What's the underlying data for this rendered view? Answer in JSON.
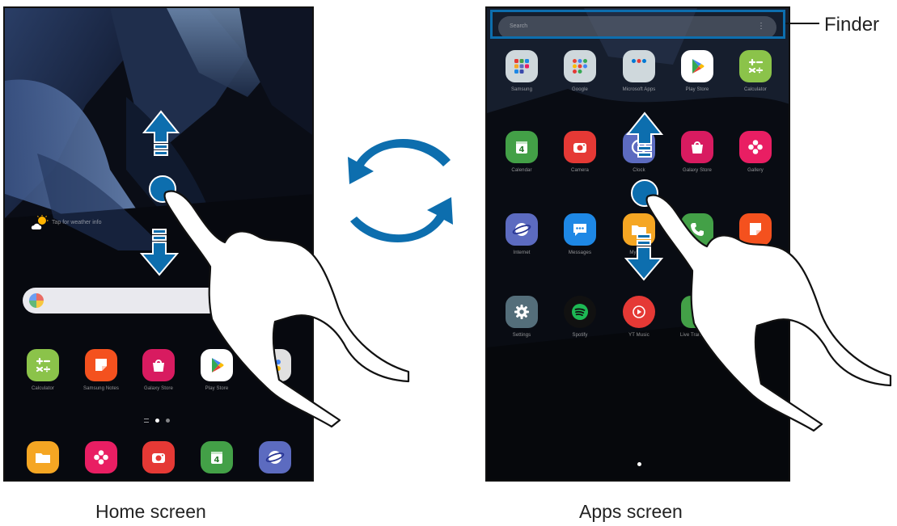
{
  "home_screen": {
    "weather_text": "Tap for weather info",
    "apps_row": [
      {
        "label": "Calculator",
        "icon": "calculator-icon",
        "color": "#8bc34a"
      },
      {
        "label": "Samsung Notes",
        "icon": "samsung-notes-icon",
        "color": "#f4511e"
      },
      {
        "label": "Galaxy Store",
        "icon": "galaxy-store-icon",
        "color": "#d81b60"
      },
      {
        "label": "Play Store",
        "icon": "play-store-icon",
        "color": "#ffffff"
      },
      {
        "label": "Google",
        "icon": "google-folder-icon",
        "color": "#e0e0e0"
      }
    ],
    "dock": [
      {
        "label": "My Files",
        "icon": "my-files-icon",
        "color": "#f5a623"
      },
      {
        "label": "Gallery",
        "icon": "gallery-icon",
        "color": "#e91e63"
      },
      {
        "label": "Camera",
        "icon": "camera-icon",
        "color": "#e53935"
      },
      {
        "label": "Calendar",
        "icon": "calendar-icon",
        "color": "#43a047"
      },
      {
        "label": "Internet",
        "icon": "internet-icon",
        "color": "#5c6bc0"
      }
    ]
  },
  "apps_screen": {
    "finder_placeholder": "Search",
    "finder_more": "⋮",
    "rows": [
      [
        {
          "label": "Samsung",
          "icon": "samsung-folder-icon",
          "color": "#cfd8dc"
        },
        {
          "label": "Google",
          "icon": "google-folder-icon",
          "color": "#cfd8dc"
        },
        {
          "label": "Microsoft Apps",
          "icon": "microsoft-folder-icon",
          "color": "#cfd8dc"
        },
        {
          "label": "Play Store",
          "icon": "play-store-icon",
          "color": "#ffffff"
        },
        {
          "label": "Calculator",
          "icon": "calculator-icon",
          "color": "#8bc34a"
        }
      ],
      [
        {
          "label": "Calendar",
          "icon": "calendar-icon",
          "color": "#43a047"
        },
        {
          "label": "Camera",
          "icon": "camera-icon",
          "color": "#e53935"
        },
        {
          "label": "Clock",
          "icon": "clock-icon",
          "color": "#5c6bc0"
        },
        {
          "label": "Galaxy Store",
          "icon": "galaxy-store-icon",
          "color": "#d81b60"
        },
        {
          "label": "Gallery",
          "icon": "gallery-icon",
          "color": "#e91e63"
        }
      ],
      [
        {
          "label": "Internet",
          "icon": "internet-icon",
          "color": "#5c6bc0"
        },
        {
          "label": "Messages",
          "icon": "messages-icon",
          "color": "#1e88e5"
        },
        {
          "label": "My Files",
          "icon": "my-files-icon",
          "color": "#f5a623"
        },
        {
          "label": "Phone",
          "icon": "phone-icon",
          "color": "#43a047"
        },
        {
          "label": "Samsung Notes",
          "icon": "samsung-notes-icon",
          "color": "#f4511e"
        }
      ],
      [
        {
          "label": "Settings",
          "icon": "settings-icon",
          "color": "#546e7a"
        },
        {
          "label": "Spotify",
          "icon": "spotify-icon",
          "color": "#1db954"
        },
        {
          "label": "YT Music",
          "icon": "yt-music-icon",
          "color": "#e53935"
        },
        {
          "label": "Live Transcribe",
          "icon": "live-transcribe-icon",
          "color": "#43a047"
        },
        {
          "label": "",
          "icon": "",
          "color": ""
        }
      ]
    ]
  },
  "annotations": {
    "finder_label": "Finder",
    "caption_home": "Home screen",
    "caption_apps": "Apps screen",
    "arrow_color": "#0d6eae"
  }
}
